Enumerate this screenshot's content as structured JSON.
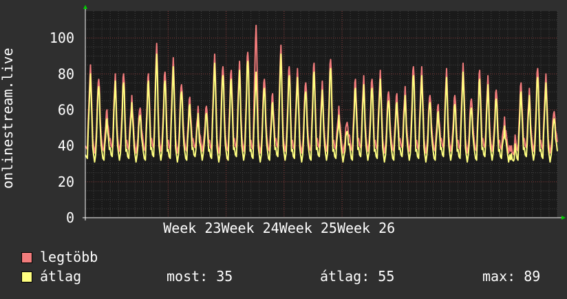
{
  "chart_data": {
    "type": "line",
    "ylabel": "onlinestream.live",
    "ylim": [
      0,
      115
    ],
    "yticks": [
      0,
      20,
      40,
      60,
      80,
      100
    ],
    "x_tick_labels": [
      "Week 23",
      "Week 24",
      "Week 25",
      "Week 26"
    ],
    "grid": true,
    "colors": {
      "background": "#2f2f2f",
      "plot_bg": "#1a1a1a",
      "grid": "#8a3a3a",
      "axis": "#ffffff",
      "arrow": "#00cc00"
    },
    "series": [
      {
        "name": "legtöbb",
        "color": "#f27c7c",
        "daily_peaks": [
          84,
          79,
          60,
          78,
          81,
          67,
          63,
          80,
          95,
          82,
          88,
          76,
          67,
          60,
          63,
          90,
          86,
          82,
          85,
          93,
          106,
          79,
          69,
          94,
          85,
          82,
          77,
          86,
          74,
          89,
          61,
          55,
          77,
          77,
          78,
          81,
          72,
          69,
          71,
          85,
          83,
          70,
          63,
          81,
          69,
          85,
          68,
          82,
          77,
          72,
          55,
          38,
          75,
          70,
          84,
          79,
          61
        ]
      },
      {
        "name": "átlag",
        "color": "#ffff80",
        "daily_peaks": [
          79,
          75,
          55,
          74,
          76,
          63,
          59,
          76,
          89,
          77,
          83,
          72,
          63,
          56,
          59,
          85,
          81,
          77,
          80,
          88,
          80,
          74,
          64,
          89,
          80,
          77,
          72,
          81,
          69,
          84,
          56,
          50,
          72,
          72,
          73,
          76,
          67,
          64,
          66,
          80,
          78,
          66,
          59,
          76,
          64,
          80,
          63,
          77,
          72,
          67,
          50,
          34,
          70,
          66,
          79,
          74,
          57
        ]
      }
    ]
  },
  "legend": {
    "max_label": "legtöbb",
    "avg_label": "átlag",
    "now_text": "most: 35",
    "avg_text": "átlag: 55",
    "max_text": "max: 89"
  }
}
